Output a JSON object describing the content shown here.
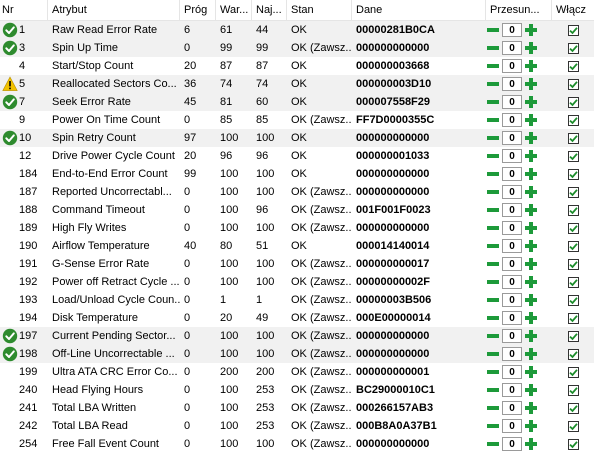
{
  "columns": {
    "nr": "Nr",
    "atrybut": "Atrybut",
    "prog": "Próg",
    "war": "War...",
    "naj": "Naj...",
    "stan": "Stan",
    "dane": "Dane",
    "przesun": "Przesun...",
    "wlacz": "Włącz"
  },
  "colors": {
    "ok_icon": "#2e8b2e",
    "warn_icon": "#f2c200",
    "minus_button": "#1d9a3a",
    "plus_button": "#1d9a3a",
    "checkbox_tick": "#1b8c2a",
    "shade_row": "#f1f1f1"
  },
  "rows": [
    {
      "nr": "1",
      "icon": "ok-icon",
      "atrybut": "Raw Read Error Rate",
      "prog": "6",
      "war": "61",
      "naj": "44",
      "stan": "OK",
      "dane": "00000281B0CA",
      "offset": "0",
      "enabled": true
    },
    {
      "nr": "3",
      "icon": "ok-icon",
      "atrybut": "Spin Up Time",
      "prog": "0",
      "war": "99",
      "naj": "99",
      "stan": "OK (Zawsz...",
      "dane": "000000000000",
      "offset": "0",
      "enabled": true
    },
    {
      "nr": "4",
      "icon": "",
      "atrybut": "Start/Stop Count",
      "prog": "20",
      "war": "87",
      "naj": "87",
      "stan": "OK",
      "dane": "000000003668",
      "offset": "0",
      "enabled": true
    },
    {
      "nr": "5",
      "icon": "warning-icon",
      "atrybut": "Reallocated Sectors Co...",
      "prog": "36",
      "war": "74",
      "naj": "74",
      "stan": "OK",
      "dane": "000000003D10",
      "offset": "0",
      "enabled": true
    },
    {
      "nr": "7",
      "icon": "ok-icon",
      "atrybut": "Seek Error Rate",
      "prog": "45",
      "war": "81",
      "naj": "60",
      "stan": "OK",
      "dane": "000007558F29",
      "offset": "0",
      "enabled": true
    },
    {
      "nr": "9",
      "icon": "",
      "atrybut": "Power On Time Count",
      "prog": "0",
      "war": "85",
      "naj": "85",
      "stan": "OK (Zawsz...",
      "dane": "FF7D0000355C",
      "offset": "0",
      "enabled": true
    },
    {
      "nr": "10",
      "icon": "ok-icon",
      "atrybut": "Spin Retry Count",
      "prog": "97",
      "war": "100",
      "naj": "100",
      "stan": "OK",
      "dane": "000000000000",
      "offset": "0",
      "enabled": true
    },
    {
      "nr": "12",
      "icon": "",
      "atrybut": "Drive Power Cycle Count",
      "prog": "20",
      "war": "96",
      "naj": "96",
      "stan": "OK",
      "dane": "000000001033",
      "offset": "0",
      "enabled": true
    },
    {
      "nr": "184",
      "icon": "",
      "atrybut": "End-to-End Error Count",
      "prog": "99",
      "war": "100",
      "naj": "100",
      "stan": "OK",
      "dane": "000000000000",
      "offset": "0",
      "enabled": true
    },
    {
      "nr": "187",
      "icon": "",
      "atrybut": "Reported Uncorrectabl...",
      "prog": "0",
      "war": "100",
      "naj": "100",
      "stan": "OK (Zawsz...",
      "dane": "000000000000",
      "offset": "0",
      "enabled": true
    },
    {
      "nr": "188",
      "icon": "",
      "atrybut": "Command Timeout",
      "prog": "0",
      "war": "100",
      "naj": "96",
      "stan": "OK (Zawsz...",
      "dane": "001F001F0023",
      "offset": "0",
      "enabled": true
    },
    {
      "nr": "189",
      "icon": "",
      "atrybut": "High Fly Writes",
      "prog": "0",
      "war": "100",
      "naj": "100",
      "stan": "OK (Zawsz...",
      "dane": "000000000000",
      "offset": "0",
      "enabled": true
    },
    {
      "nr": "190",
      "icon": "",
      "atrybut": "Airflow Temperature",
      "prog": "40",
      "war": "80",
      "naj": "51",
      "stan": "OK",
      "dane": "000014140014",
      "offset": "0",
      "enabled": true
    },
    {
      "nr": "191",
      "icon": "",
      "atrybut": "G-Sense Error Rate",
      "prog": "0",
      "war": "100",
      "naj": "100",
      "stan": "OK (Zawsz...",
      "dane": "000000000017",
      "offset": "0",
      "enabled": true
    },
    {
      "nr": "192",
      "icon": "",
      "atrybut": "Power off Retract Cycle ...",
      "prog": "0",
      "war": "100",
      "naj": "100",
      "stan": "OK (Zawsz...",
      "dane": "00000000002F",
      "offset": "0",
      "enabled": true
    },
    {
      "nr": "193",
      "icon": "",
      "atrybut": "Load/Unload Cycle Coun...",
      "prog": "0",
      "war": "1",
      "naj": "1",
      "stan": "OK (Zawsz...",
      "dane": "00000003B506",
      "offset": "0",
      "enabled": true
    },
    {
      "nr": "194",
      "icon": "",
      "atrybut": "Disk Temperature",
      "prog": "0",
      "war": "20",
      "naj": "49",
      "stan": "OK (Zawsz...",
      "dane": "000E00000014",
      "offset": "0",
      "enabled": true
    },
    {
      "nr": "197",
      "icon": "ok-icon",
      "atrybut": "Current Pending Sector...",
      "prog": "0",
      "war": "100",
      "naj": "100",
      "stan": "OK (Zawsz...",
      "dane": "000000000000",
      "offset": "0",
      "enabled": true
    },
    {
      "nr": "198",
      "icon": "ok-icon",
      "atrybut": "Off-Line Uncorrectable ...",
      "prog": "0",
      "war": "100",
      "naj": "100",
      "stan": "OK (Zawsz...",
      "dane": "000000000000",
      "offset": "0",
      "enabled": true
    },
    {
      "nr": "199",
      "icon": "",
      "atrybut": "Ultra ATA CRC Error Co...",
      "prog": "0",
      "war": "200",
      "naj": "200",
      "stan": "OK (Zawsz...",
      "dane": "000000000001",
      "offset": "0",
      "enabled": true
    },
    {
      "nr": "240",
      "icon": "",
      "atrybut": "Head Flying Hours",
      "prog": "0",
      "war": "100",
      "naj": "253",
      "stan": "OK (Zawsz...",
      "dane": "BC29000010C1",
      "offset": "0",
      "enabled": true
    },
    {
      "nr": "241",
      "icon": "",
      "atrybut": "Total LBA Written",
      "prog": "0",
      "war": "100",
      "naj": "253",
      "stan": "OK (Zawsz...",
      "dane": "000266157AB3",
      "offset": "0",
      "enabled": true
    },
    {
      "nr": "242",
      "icon": "",
      "atrybut": "Total LBA Read",
      "prog": "0",
      "war": "100",
      "naj": "253",
      "stan": "OK (Zawsz...",
      "dane": "000B8A0A37B1",
      "offset": "0",
      "enabled": true
    },
    {
      "nr": "254",
      "icon": "",
      "atrybut": "Free Fall Event Count",
      "prog": "0",
      "war": "100",
      "naj": "100",
      "stan": "OK (Zawsz...",
      "dane": "000000000000",
      "offset": "0",
      "enabled": true
    }
  ]
}
